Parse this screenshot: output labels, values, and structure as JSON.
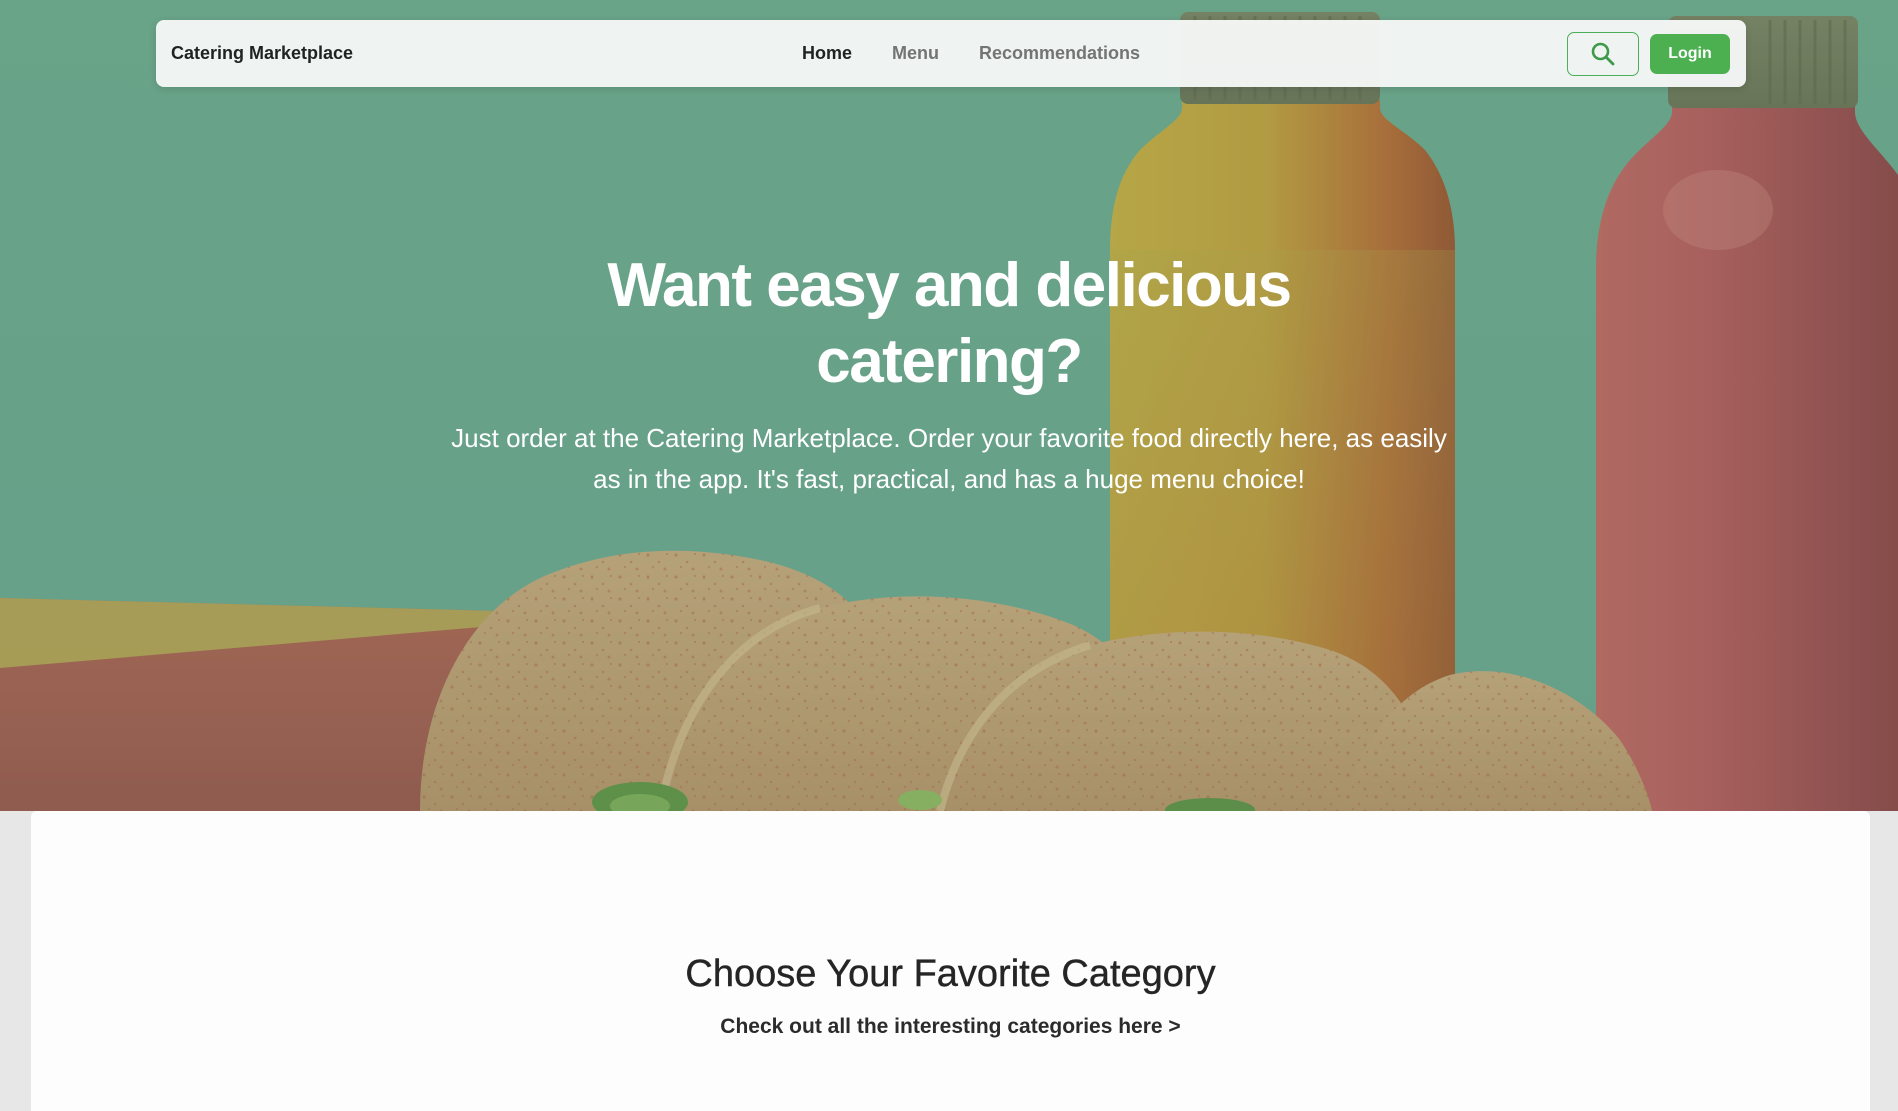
{
  "navbar": {
    "brand": "Catering Marketplace",
    "links": [
      {
        "label": "Home",
        "active": true
      },
      {
        "label": "Menu",
        "active": false
      },
      {
        "label": "Recommendations",
        "active": false
      }
    ],
    "search_icon": "search-icon",
    "login_label": "Login"
  },
  "hero": {
    "title": "Want easy and delicious catering?",
    "subtitle": "Just order at the Catering Marketplace. Order your favorite food directly here, as easily as in the app. It's fast, practical, and has a huge menu choice!"
  },
  "section": {
    "title": "Choose Your Favorite Category",
    "link": "Check out all the interesting categories here >"
  },
  "colors": {
    "accent": "#4caf50",
    "hero_overlay": "#6b9f87",
    "card_bg": "#fdfdfd",
    "page_bg": "#e6e7e6"
  }
}
